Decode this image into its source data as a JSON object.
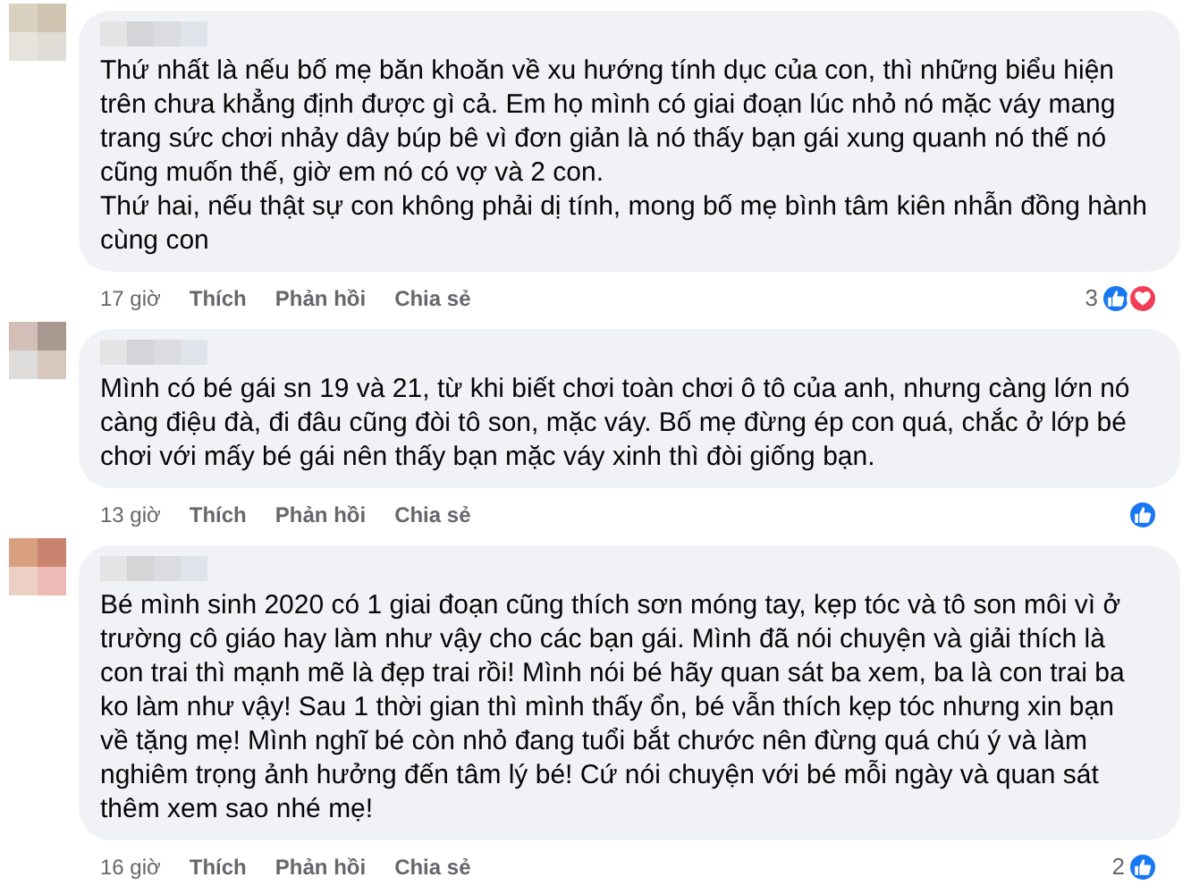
{
  "comments": [
    {
      "paragraphs": [
        "Thứ nhất là nếu bố mẹ băn khoăn về xu hướng tính dục của con, thì những biểu hiện trên chưa khẳng định được gì cả. Em họ mình có giai đoạn lúc nhỏ nó mặc váy mang trang sức chơi nhảy dây búp bê vì đơn giản là nó thấy bạn gái xung quanh nó thế nó cũng muốn thế, giờ em nó có vợ và 2 con.",
        "Thứ hai, nếu thật sự con không phải dị tính, mong bố mẹ bình tâm kiên nhẫn đồng hành cùng con"
      ],
      "time": "17 giờ",
      "actions": [
        "Thích",
        "Phản hồi",
        "Chia sẻ"
      ],
      "reaction_count": "3",
      "reactions": [
        {
          "kind": "like"
        },
        {
          "kind": "love"
        }
      ]
    },
    {
      "paragraphs": [
        "Mình có bé gái sn 19 và 21, từ khi biết chơi toàn chơi ô tô của anh, nhưng càng lớn nó càng điệu đà, đi đâu cũng đòi tô son, mặc váy. Bố mẹ đừng ép con quá, chắc ở lớp bé chơi với mấy bé gái nên thấy bạn mặc váy xinh thì đòi giống bạn."
      ],
      "time": "13 giờ",
      "actions": [
        "Thích",
        "Phản hồi",
        "Chia sẻ"
      ],
      "reactions": [
        {
          "kind": "like"
        }
      ]
    },
    {
      "paragraphs": [
        "Bé mình sinh 2020 có 1 giai đoạn cũng thích sơn móng tay, kẹp tóc và tô son môi vì ở trường cô giáo hay làm như vậy cho các bạn gái. Mình đã nói chuyện và giải thích là con trai thì mạnh mẽ là đẹp trai rồi! Mình nói bé hãy quan sát ba xem, ba là con trai ba ko làm như vậy! Sau 1 thời gian thì mình thấy ổn, bé vẫn thích kẹp tóc nhưng xin bạn về tặng mẹ! Mình nghĩ bé còn nhỏ đang tuổi bắt chước nên đừng quá chú ý và làm nghiêm trọng ảnh hưởng đến tâm lý bé! Cứ nói chuyện với bé mỗi ngày và quan sát thêm xem sao nhé mẹ!"
      ],
      "time": "16 giờ",
      "actions": [
        "Thích",
        "Phản hồi",
        "Chia sẻ"
      ],
      "reaction_count": "2",
      "reactions": [
        {
          "kind": "like"
        }
      ]
    }
  ]
}
